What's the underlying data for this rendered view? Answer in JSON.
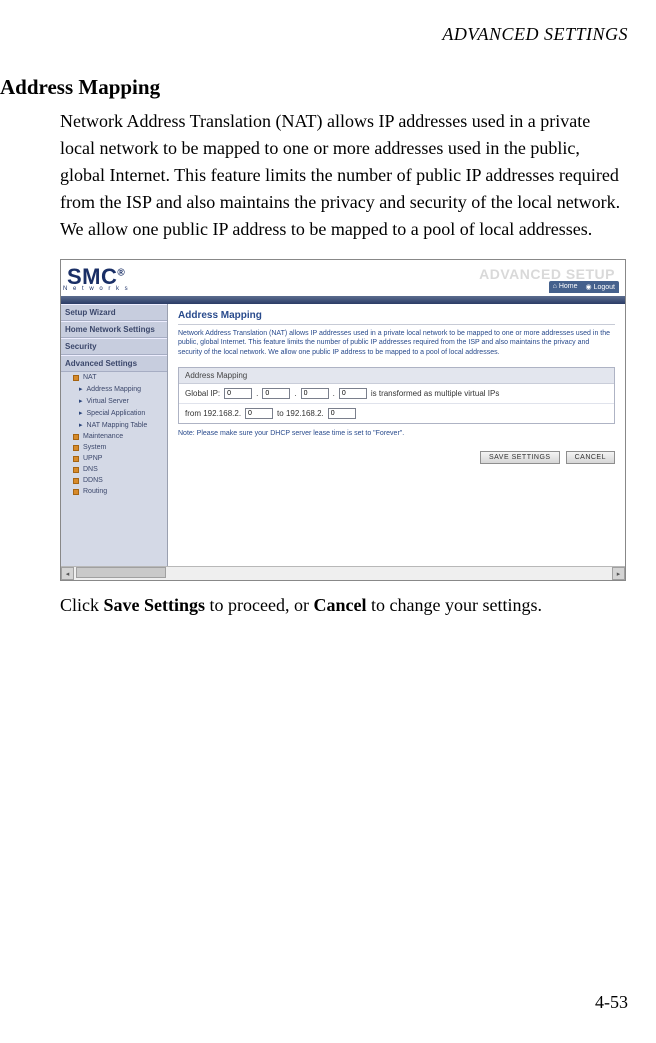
{
  "page": {
    "header": "ADVANCED SETTINGS",
    "number": "4-53"
  },
  "section": {
    "title": "Address Mapping",
    "paragraph": "Network Address Translation (NAT) allows IP addresses used in a private local network to be mapped to one or more addresses used in the public, global Internet. This feature limits the number of public IP addresses required from the ISP and also maintains the privacy and security of the local network. We allow one public IP address to be mapped to a pool of local addresses.",
    "closing_pre": "Click ",
    "closing_b1": "Save Settings",
    "closing_mid": " to proceed, or ",
    "closing_b2": "Cancel",
    "closing_post": " to change your settings."
  },
  "shot": {
    "brand": "SMC",
    "brand_reg": "®",
    "brand_sub": "N e t w o r k s",
    "banner": "ADVANCED SETUP",
    "topnav": {
      "home": "Home",
      "logout": "Logout"
    },
    "sidebar": {
      "setup_wizard": "Setup Wizard",
      "home_net": "Home Network Settings",
      "security": "Security",
      "advanced": "Advanced Settings",
      "nat": "NAT",
      "address_mapping": "Address Mapping",
      "virtual_server": "Virtual Server",
      "special_app": "Special Application",
      "nat_mapping_table": "NAT Mapping Table",
      "maintenance": "Maintenance",
      "system": "System",
      "upnp": "UPNP",
      "dns": "DNS",
      "ddns": "DDNS",
      "routing": "Routing"
    },
    "content": {
      "title": "Address Mapping",
      "desc": "Network Address Translation (NAT) allows IP addresses used in a private local network to be mapped to one or more addresses used in the public, global Internet. This feature limits the number of public IP addresses required from the ISP and also maintains the privacy and security of the local network. We allow one public IP address to be mapped to a pool of local addresses.",
      "box_heading": "Address Mapping",
      "global_ip_label": "Global IP:",
      "global_ip": {
        "a": "0",
        "b": "0",
        "c": "0",
        "d": "0"
      },
      "global_ip_tail": " is transformed as multiple virtual IPs",
      "from_label": "from 192.168.2.",
      "from_val": "0",
      "to_label": " to 192.168.2.",
      "to_val": "0",
      "note": "Note: Please make sure your DHCP server lease time is set to \"Forever\".",
      "save_btn": "SAVE SETTINGS",
      "cancel_btn": "CANCEL"
    }
  }
}
